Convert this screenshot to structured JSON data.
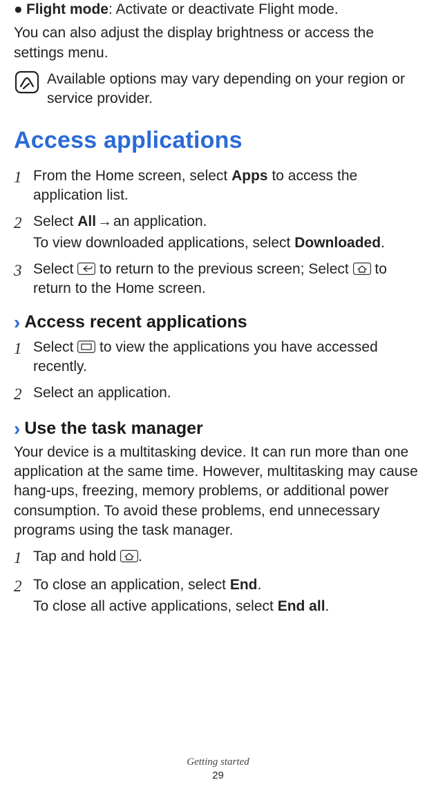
{
  "bullet": {
    "label": "Flight mode",
    "desc": ": Activate or deactivate Flight mode."
  },
  "intro2": "You can also adjust the display brightness or access the settings menu.",
  "note": "Available options may vary depending on your region or service provider.",
  "h1": "Access applications",
  "steps_a": [
    {
      "num": "1",
      "pre": "From the Home screen, select ",
      "bold": "Apps",
      "post": " to access the application list."
    },
    {
      "num": "2",
      "pre": "Select ",
      "bold": "All",
      "arrow": " → ",
      "post": "an application.",
      "sub_pre": "To view downloaded applications, select ",
      "sub_bold": "Downloaded",
      "sub_post": "."
    },
    {
      "num": "3",
      "pre": "Select ",
      "mid": " to return to the previous screen; Select ",
      "post": " to return to the Home screen."
    }
  ],
  "h2a": "Access recent applications",
  "steps_b": [
    {
      "num": "1",
      "pre": "Select ",
      "post": " to view the applications you have accessed recently."
    },
    {
      "num": "2",
      "text": "Select an application."
    }
  ],
  "h2b": "Use the task manager",
  "task_para": "Your device is a multitasking device. It can run more than one application at the same time. However, multitasking may cause hang-ups, freezing, memory problems, or additional power consumption. To avoid these problems, end unnecessary programs using the task manager.",
  "steps_c": [
    {
      "num": "1",
      "pre": "Tap and hold ",
      "post": "."
    },
    {
      "num": "2",
      "pre": "To close an application, select ",
      "bold": "End",
      "post": ".",
      "sub_pre": "To close all active applications, select ",
      "sub_bold": "End all",
      "sub_post": "."
    }
  ],
  "footer_section": "Getting started",
  "footer_page": "29"
}
